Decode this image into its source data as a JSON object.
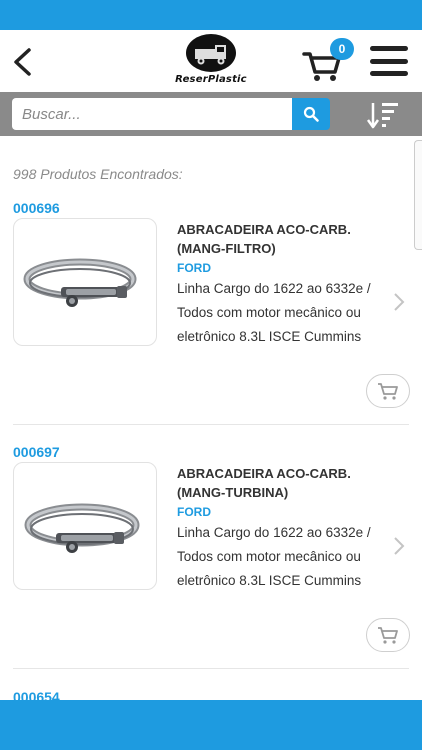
{
  "header": {
    "logo_text": "ReserPlastic",
    "cart_count": "0",
    "icons": {
      "back": "chevron-left-icon",
      "cart": "cart-icon",
      "menu": "hamburger-menu-icon"
    }
  },
  "search": {
    "placeholder": "Buscar...",
    "value": "",
    "icons": {
      "search": "search-icon",
      "sort": "sort-descending-icon"
    }
  },
  "results": {
    "count_label": "998 Produtos Encontrados:"
  },
  "products": [
    {
      "code": "000696",
      "title": "ABRACADEIRA ACO-CARB. (MANG-FILTRO)",
      "brand": "FORD",
      "description": "Linha Cargo do 1622 ao 6332e / Todos com motor mecânico ou eletrônico 8.3L ISCE Cummins"
    },
    {
      "code": "000697",
      "title": "ABRACADEIRA ACO-CARB. (MANG-TURBINA)",
      "brand": "FORD",
      "description": "Linha Cargo do 1622 ao 6332e / Todos com motor mecânico ou eletrônico 8.3L ISCE Cummins"
    }
  ],
  "partial_next_code": "000654",
  "colors": {
    "accent": "#1e9be0",
    "search_bar": "#8a8a8a",
    "text": "#333333"
  }
}
